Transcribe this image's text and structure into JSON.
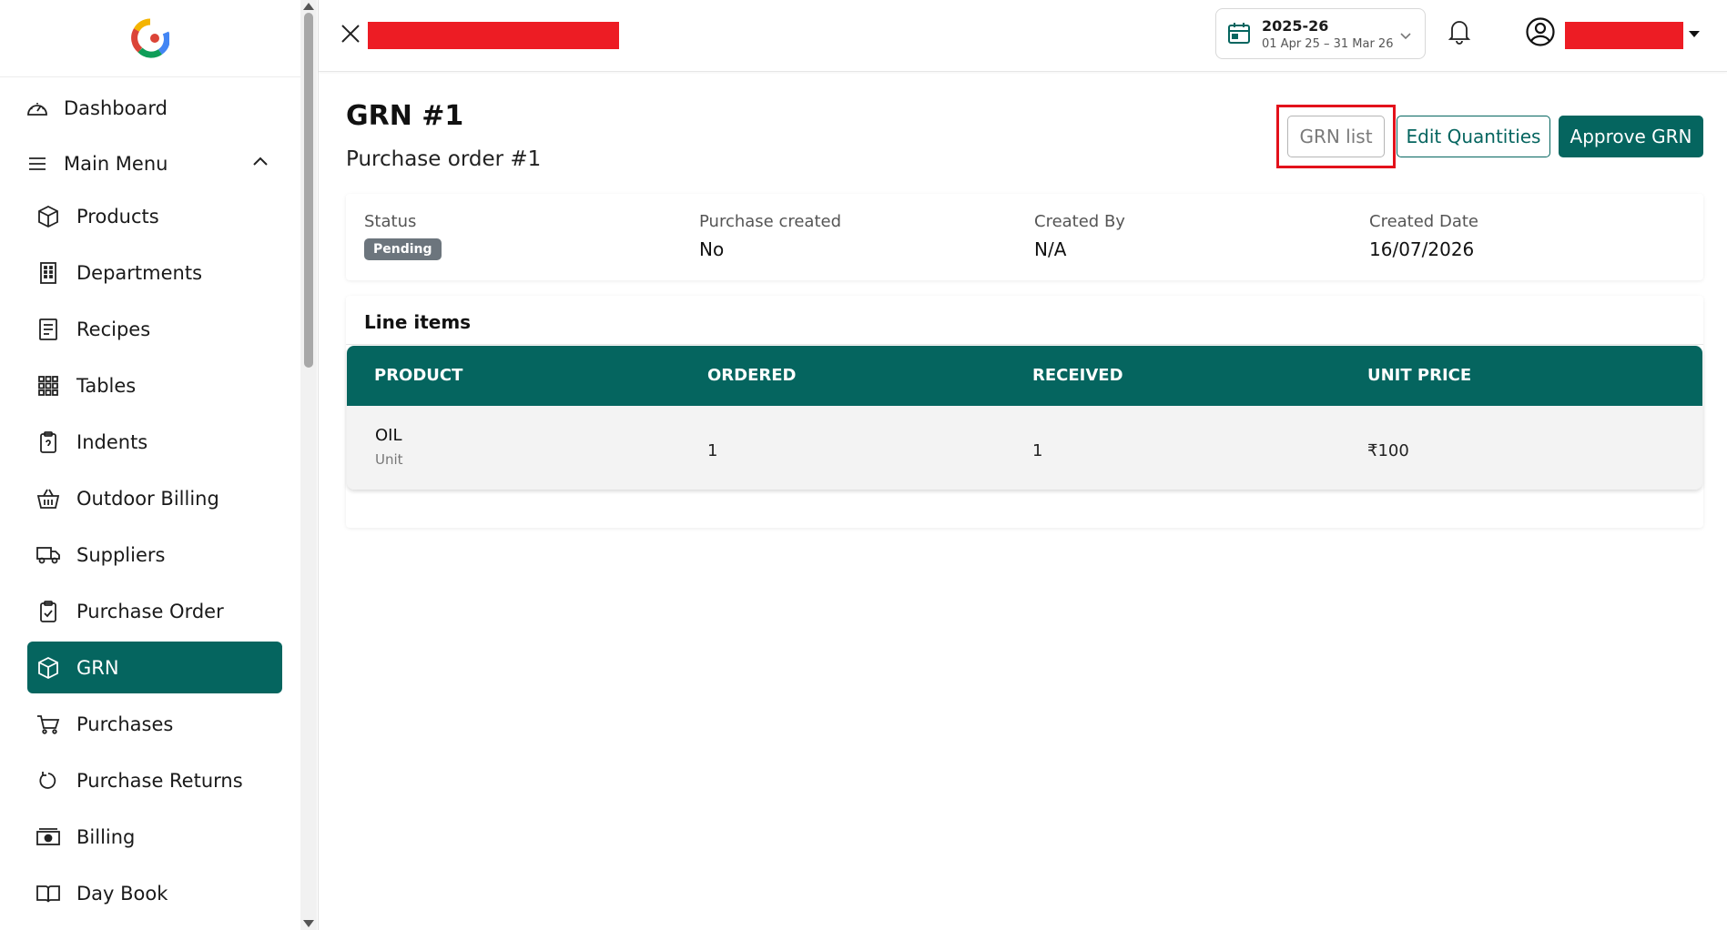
{
  "sidebar": {
    "top_items": [
      {
        "label": "Dashboard",
        "icon": "gauge-icon"
      },
      {
        "label": "Main Menu",
        "icon": "menu-icon"
      }
    ],
    "items": [
      {
        "label": "Products",
        "icon": "box-icon"
      },
      {
        "label": "Departments",
        "icon": "building-icon"
      },
      {
        "label": "Recipes",
        "icon": "receipt-icon"
      },
      {
        "label": "Tables",
        "icon": "grid-icon"
      },
      {
        "label": "Indents",
        "icon": "clipboard-icon"
      },
      {
        "label": "Outdoor Billing",
        "icon": "basket-icon"
      },
      {
        "label": "Suppliers",
        "icon": "truck-icon"
      },
      {
        "label": "Purchase Order",
        "icon": "clipboard-check-icon"
      },
      {
        "label": "GRN",
        "icon": "box-icon",
        "active": true
      },
      {
        "label": "Purchases",
        "icon": "cart-icon"
      },
      {
        "label": "Purchase Returns",
        "icon": "rotate-icon"
      },
      {
        "label": "Billing",
        "icon": "cash-icon"
      },
      {
        "label": "Day Book",
        "icon": "book-icon"
      }
    ]
  },
  "header": {
    "fy_year": "2025-26",
    "fy_range": "01 Apr 25 – 31 Mar 26"
  },
  "page": {
    "title": "GRN #1",
    "subtitle": "Purchase order #1"
  },
  "actions": {
    "grn_list": "GRN list",
    "edit_quantities": "Edit Quantities",
    "approve": "Approve GRN"
  },
  "info": {
    "status_label": "Status",
    "status_value": "Pending",
    "purchase_created_label": "Purchase created",
    "purchase_created_value": "No",
    "created_by_label": "Created By",
    "created_by_value": "N/A",
    "created_date_label": "Created Date",
    "created_date_value": "16/07/2026"
  },
  "line_items": {
    "title": "Line items",
    "columns": [
      "PRODUCT",
      "ORDERED",
      "RECEIVED",
      "UNIT PRICE"
    ],
    "rows": [
      {
        "product": "OIL",
        "unit": "Unit",
        "ordered": "1",
        "received": "1",
        "unit_price": "₹100"
      }
    ]
  },
  "colors": {
    "accent": "#05655f",
    "highlight": "#e3111b",
    "redaction": "#ed1c24",
    "badge": "#6c757d"
  }
}
